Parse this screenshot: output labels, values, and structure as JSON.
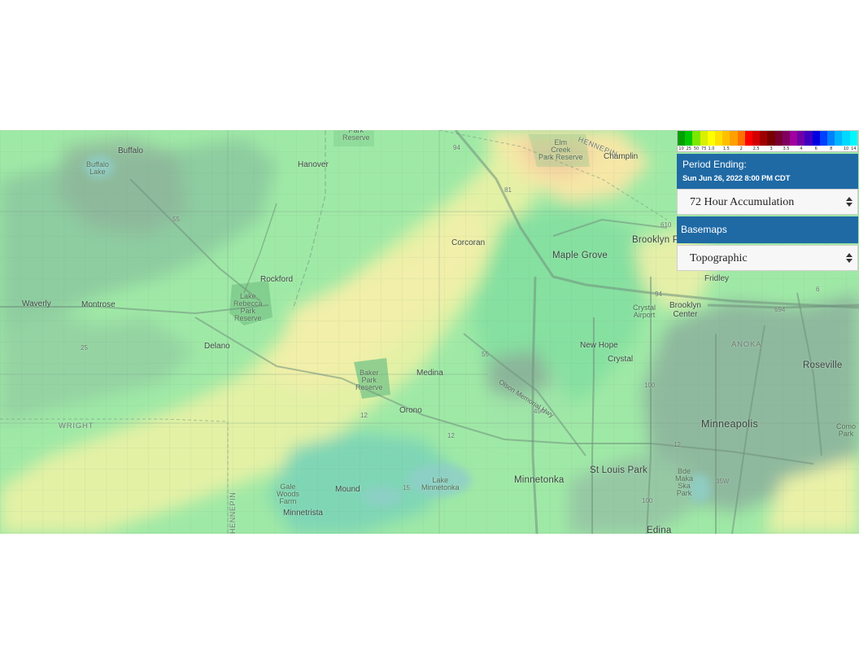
{
  "map": {
    "cities": [
      {
        "name": "Buffalo",
        "cls": "lbl"
      },
      {
        "name": "Hanover",
        "cls": "lbl"
      },
      {
        "name": "Rockford",
        "cls": "lbl"
      },
      {
        "name": "Waverly",
        "cls": "lbl"
      },
      {
        "name": "Montrose",
        "cls": "lbl"
      },
      {
        "name": "Delano",
        "cls": "lbl"
      },
      {
        "name": "Corcoran",
        "cls": "lbl"
      },
      {
        "name": "Maple Grove",
        "cls": "lbl big"
      },
      {
        "name": "Brooklyn P",
        "cls": "lbl big"
      },
      {
        "name": "Champlin",
        "cls": "lbl"
      },
      {
        "name": "Medina",
        "cls": "lbl"
      },
      {
        "name": "Orono",
        "cls": "lbl"
      },
      {
        "name": "New Hope",
        "cls": "lbl"
      },
      {
        "name": "Crystal",
        "cls": "lbl"
      },
      {
        "name": "Brooklyn\nCenter",
        "cls": "lbl"
      },
      {
        "name": "Fridley",
        "cls": "lbl"
      },
      {
        "name": "ANOKA",
        "cls": "lbl county"
      },
      {
        "name": "Roseville",
        "cls": "lbl big"
      },
      {
        "name": "Minneapolis",
        "cls": "lbl huge"
      },
      {
        "name": "WRIGHT",
        "cls": "lbl county"
      },
      {
        "name": "Minnetonka",
        "cls": "lbl big"
      },
      {
        "name": "St Louis Park",
        "cls": "lbl big"
      },
      {
        "name": "Mound",
        "cls": "lbl"
      },
      {
        "name": "Minnetrista",
        "cls": "lbl"
      },
      {
        "name": "Edina",
        "cls": "lbl big"
      }
    ],
    "parks": [
      "Buffalo\nLake",
      "Park\nReserve",
      "Elm\nCreek\nPark Reserve",
      "Lake\nRebecca\nPark\nReserve",
      "Baker\nPark\nReserve",
      "Crystal\nAirport",
      "Lake\nMinnetonka",
      "Gale\nWoods\nFarm",
      "Bde\nMaka\nSka\nPark",
      "Como\nPark"
    ],
    "roads": [
      "55",
      "94",
      "610",
      "94",
      "694",
      "25",
      "55",
      "12",
      "12",
      "494",
      "15",
      "100",
      "100",
      "35W",
      "6",
      "12",
      "81"
    ],
    "diagonal_road": "Olson Memorial Hwy",
    "vertical_labels": [
      "HENNEPIN",
      "HENNEPIN"
    ]
  },
  "legend": {
    "colors": [
      "#00a000",
      "#00c800",
      "#7be800",
      "#d8f000",
      "#ffff00",
      "#ffe000",
      "#ffc000",
      "#ffa000",
      "#ff7000",
      "#ff0000",
      "#d40000",
      "#a00000",
      "#780000",
      "#780030",
      "#800060",
      "#a000a0",
      "#7000a8",
      "#4000c0",
      "#0000e0",
      "#0040ff",
      "#0080ff",
      "#00b4ff",
      "#00d8ff",
      "#00f8ff"
    ],
    "ticks": [
      "10",
      "25",
      "50",
      "75",
      "1.0",
      "",
      "1.5",
      "",
      "2",
      "",
      "2.5",
      "",
      "3",
      "",
      "3.5",
      "",
      "4",
      "",
      "6",
      "",
      "8",
      "",
      "10",
      "14"
    ]
  },
  "period": {
    "heading": "Period Ending:",
    "date": "Sun Jun 26, 2022 8:00 PM CDT"
  },
  "accumulation_select": {
    "value": "72 Hour Accumulation"
  },
  "basemaps": {
    "heading": "Basemaps",
    "value": "Topographic"
  }
}
